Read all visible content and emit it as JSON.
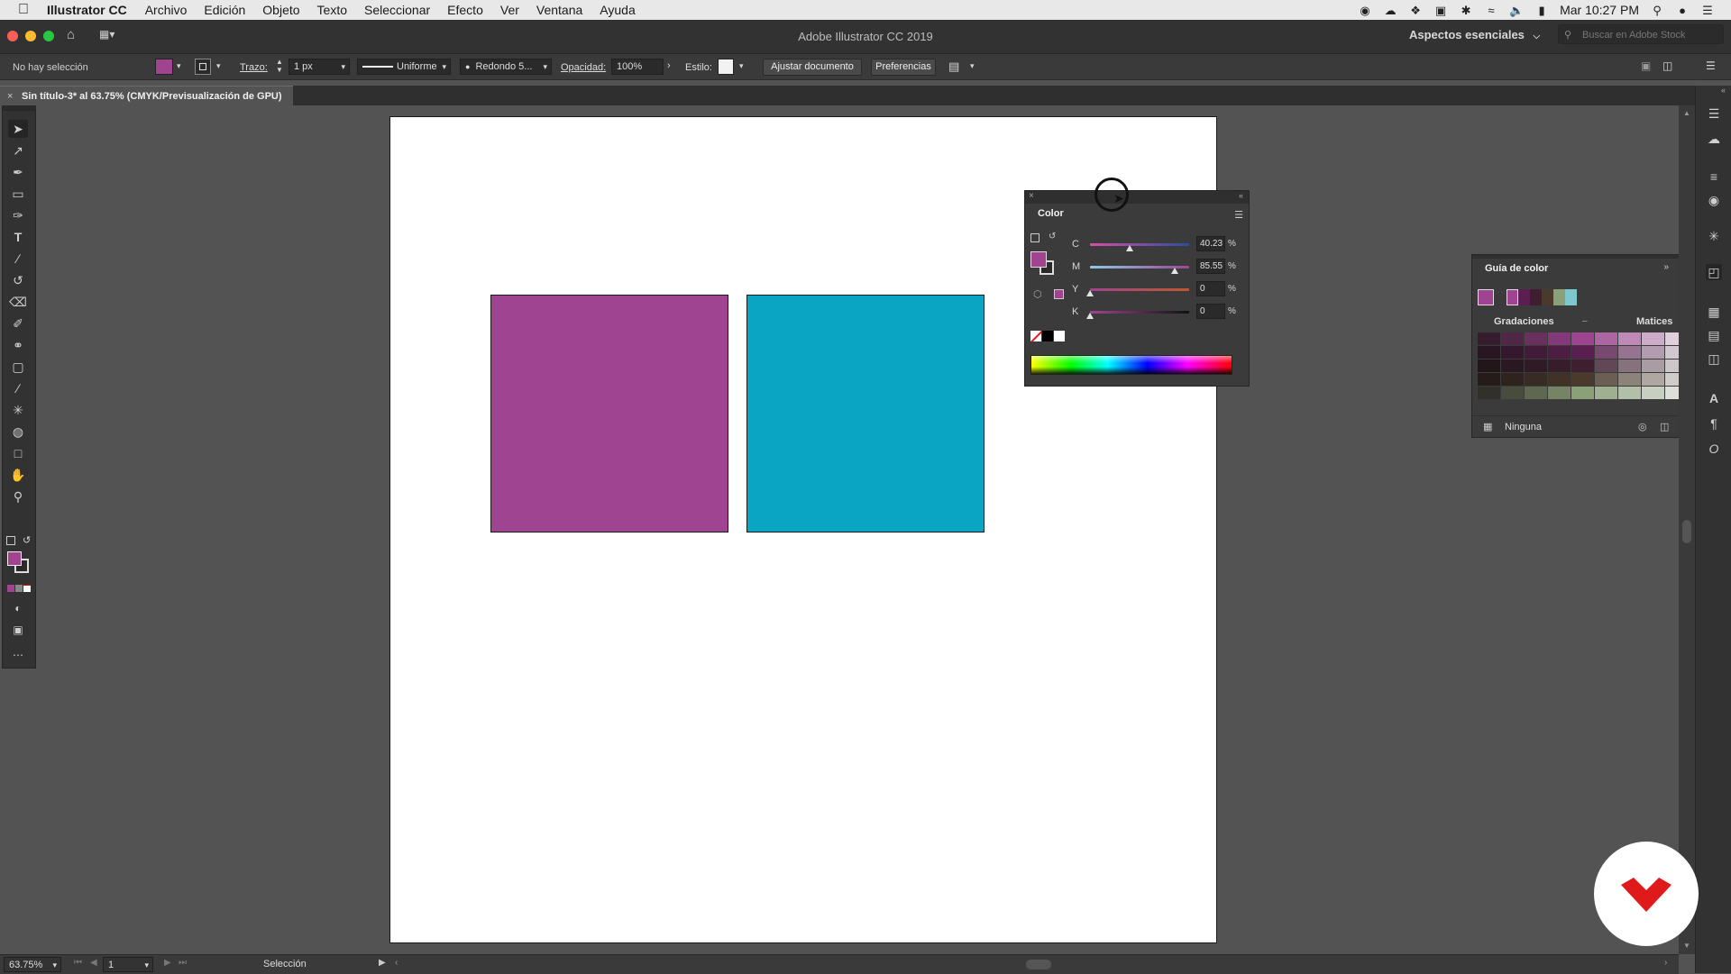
{
  "menubar": {
    "app_name": "Illustrator CC",
    "items": [
      "Archivo",
      "Edición",
      "Objeto",
      "Texto",
      "Seleccionar",
      "Efecto",
      "Ver",
      "Ventana",
      "Ayuda"
    ],
    "clock": "Mar 10:27 PM"
  },
  "titlebar": {
    "title": "Adobe Illustrator CC 2019",
    "workspace": "Aspectos esenciales",
    "stock_search_placeholder": "Buscar en Adobe Stock"
  },
  "control_bar": {
    "selection_status": "No hay selección",
    "stroke_label": "Trazo:",
    "stroke_weight": "1 px",
    "stroke_profile": "Uniforme",
    "brush": "Redondo 5...",
    "opacity_label": "Opacidad:",
    "opacity_value": "100%",
    "style_label": "Estilo:",
    "document_setup_button": "Ajustar documento",
    "preferences_button": "Preferencias"
  },
  "document_tab": {
    "title": "Sin título-3* al 63.75% (CMYK/Previsualización de GPU)"
  },
  "artboard": {
    "shapes": [
      {
        "name": "magenta-square",
        "fill": "#9e4490"
      },
      {
        "name": "cyan-square",
        "fill": "#0aa5c2"
      }
    ]
  },
  "color_panel": {
    "tab_label": "Color",
    "fill_color": "#a0448f",
    "sliders": [
      {
        "label": "C",
        "value": "40.23",
        "fraction": 0.4023
      },
      {
        "label": "M",
        "value": "85.55",
        "fraction": 0.8555
      },
      {
        "label": "Y",
        "value": "0",
        "fraction": 0
      },
      {
        "label": "K",
        "value": "0",
        "fraction": 0
      }
    ],
    "percent_sign": "%"
  },
  "color_guide_panel": {
    "tab_label": "Guía de color",
    "harmony_swatches": [
      "#9e4490",
      "#5a1f50",
      "#3e1e2f",
      "#4a3a2c",
      "#8aa078",
      "#7cc8cc"
    ],
    "variation_left_label": "Gradaciones",
    "variation_right_label": "Matices",
    "footer_label": "Ninguna"
  },
  "status_bar": {
    "zoom": "63.75%",
    "artboard_number": "1",
    "current_tool": "Selección"
  },
  "colors": {
    "ui_background": "#535353",
    "panel": "#3b3b3b",
    "accent_fill": "#a0448f"
  }
}
